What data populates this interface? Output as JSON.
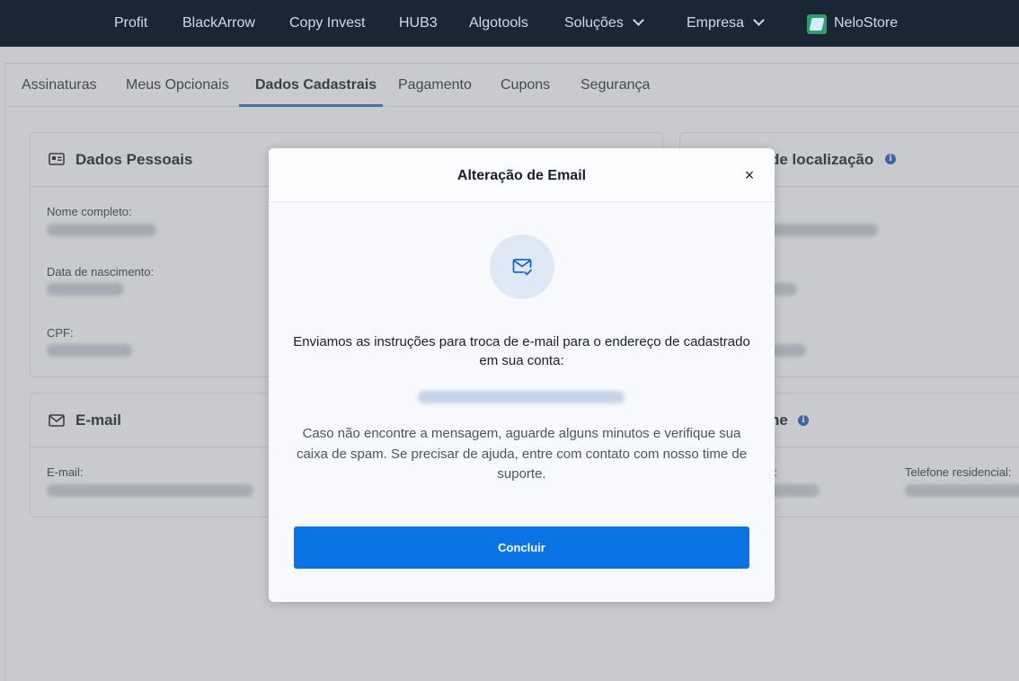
{
  "topnav": {
    "items": [
      "Profit",
      "BlackArrow",
      "Copy Invest",
      "HUB3",
      "Algotools",
      "Soluções",
      "Empresa",
      "NeloStore"
    ]
  },
  "tabs": [
    "Assinaturas",
    "Meus Opcionais",
    "Dados Cadastrais",
    "Pagamento",
    "Cupons",
    "Segurança"
  ],
  "active_tab": "Dados Cadastrais",
  "cards": {
    "personal": {
      "title": "Dados Pessoais",
      "fields": [
        "Nome completo:",
        "Data de nascimento:",
        "CPF:"
      ]
    },
    "location": {
      "title_visible": "de localização"
    },
    "email": {
      "title": "E-mail",
      "field": "E-mail:"
    },
    "phone": {
      "title_visible": "ne",
      "field_left_visible": "r:",
      "field_right": "Telefone residencial:"
    }
  },
  "modal": {
    "title": "Alteração de Email",
    "close": "×",
    "message": "Enviamos as instruções para troca de e-mail para o endereço de cadastrado em sua conta:",
    "help": "Caso não encontre a mensagem, aguarde alguns minutos e verifique sua caixa de spam. Se precisar de ajuda, entre com contato com nosso time de suporte.",
    "button": "Concluir"
  },
  "colors": {
    "nav_bg": "#1b2634",
    "primary": "#0a73e6",
    "tab_underline": "#2c6fb8",
    "info": "#1d5fbf"
  },
  "icons": [
    "id-card-icon",
    "mail-icon",
    "mail-check-icon",
    "info-icon",
    "chevron-down-icon",
    "nelostore-logo-icon"
  ]
}
